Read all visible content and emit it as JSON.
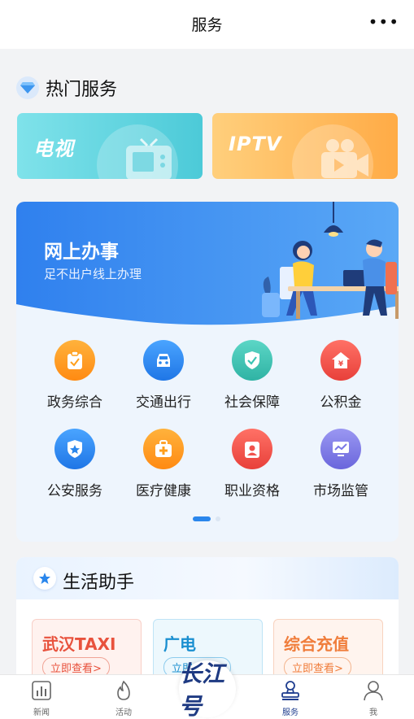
{
  "header": {
    "title": "服务",
    "more_icon": "more-dots-icon"
  },
  "hot_services": {
    "title": "热门服务",
    "icon": "diamond-icon",
    "tiles": [
      {
        "label": "电视",
        "icon": "tv-icon",
        "color": "#4ccad8"
      },
      {
        "label": "IPTV",
        "icon": "video-camera-icon",
        "color": "#ffab46"
      }
    ]
  },
  "online_affairs": {
    "title": "网上办事",
    "subtitle": "足不出户线上办理",
    "accent": "#2a86ec",
    "services": [
      {
        "label": "政务综合",
        "icon": "clipboard-icon",
        "color": "#ff9f1c"
      },
      {
        "label": "交通出行",
        "icon": "car-icon",
        "color": "#2a86ec"
      },
      {
        "label": "社会保障",
        "icon": "shield-check-icon",
        "color": "#3ac4b3"
      },
      {
        "label": "公积金",
        "icon": "house-yen-icon",
        "color": "#f0524c"
      },
      {
        "label": "公安服务",
        "icon": "police-badge-icon",
        "color": "#2a86ec"
      },
      {
        "label": "医疗健康",
        "icon": "medical-kit-icon",
        "color": "#ff9f1c"
      },
      {
        "label": "职业资格",
        "icon": "id-badge-icon",
        "color": "#f0524c"
      },
      {
        "label": "市场监管",
        "icon": "monitor-chart-icon",
        "color": "#7b78e6"
      }
    ],
    "page_indicator": {
      "current": 1,
      "total": 2
    }
  },
  "life_helper": {
    "title": "生活助手",
    "icon": "star-icon",
    "cards": [
      {
        "title": "武汉TAXI",
        "button": "立即查看>",
        "color": "#e8523d"
      },
      {
        "title": "广电",
        "button": "立即查看>",
        "color": "#1a8fd0"
      },
      {
        "title": "综合充值",
        "button": "立即查看>",
        "color": "#f07d3b"
      }
    ]
  },
  "tabbar": {
    "accent": "#1e3d8f",
    "items": [
      {
        "label": "新闻",
        "icon": "news-chart-icon",
        "active": false
      },
      {
        "label": "活动",
        "icon": "flame-icon",
        "active": false
      },
      {
        "label": "服务",
        "icon": "stamp-icon",
        "active": true
      },
      {
        "label": "我",
        "icon": "user-icon",
        "active": false
      }
    ],
    "center_logo": "长江号"
  }
}
